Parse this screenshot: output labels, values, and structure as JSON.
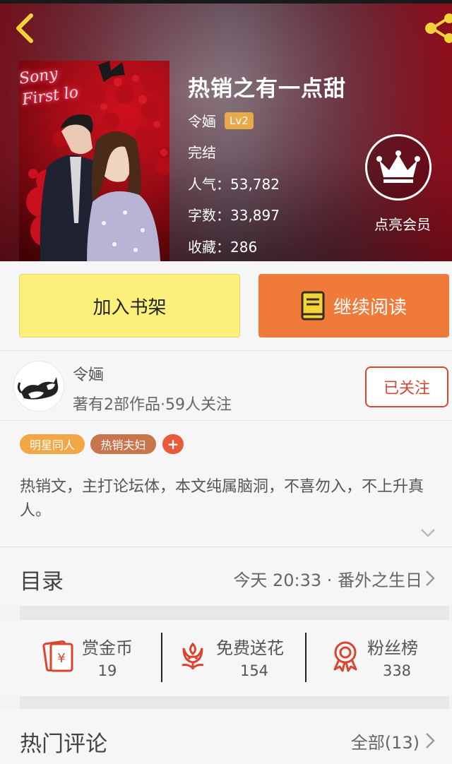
{
  "book": {
    "title": "热销之有一点甜",
    "author": "令婳",
    "level": "Lv2",
    "status": "完结",
    "popularity": "人气：53,782",
    "word_count": "字数：33,897",
    "favorites": "收藏：286",
    "cover_neon_text": "Sony\nFirst lo"
  },
  "vip": {
    "label": "点亮会员"
  },
  "actions": {
    "add_shelf": "加入书架",
    "continue_read": "继续阅读"
  },
  "author_card": {
    "name": "令婳",
    "stats": "著有2部作品·59人关注",
    "follow_label": "已关注"
  },
  "tags": {
    "items": [
      "明星同人",
      "热销夫妇"
    ],
    "add": "+"
  },
  "description": "热销文，主打论坛体，本文纯属脑洞，不喜勿入，不上升真人。",
  "catalog": {
    "label": "目录",
    "latest": "今天 20:33 · 番外之生日"
  },
  "stats": [
    {
      "label": "赏金币",
      "value": "19",
      "icon": "red-envelope-yen-icon"
    },
    {
      "label": "免费送花",
      "value": "154",
      "icon": "flower-icon"
    },
    {
      "label": "粉丝榜",
      "value": "338",
      "icon": "ribbon-medal-icon"
    }
  ],
  "comments": {
    "label": "热门评论",
    "all": "全部(13)"
  },
  "colors": {
    "accent_red": "#d9452f",
    "shelf_button": "#fdf07a",
    "read_button": "#f07a3a",
    "level_badge": "#e8a94a",
    "tag_1": "#f2a644",
    "tag_2": "#c8744c",
    "tag_add": "#e75a3a"
  }
}
